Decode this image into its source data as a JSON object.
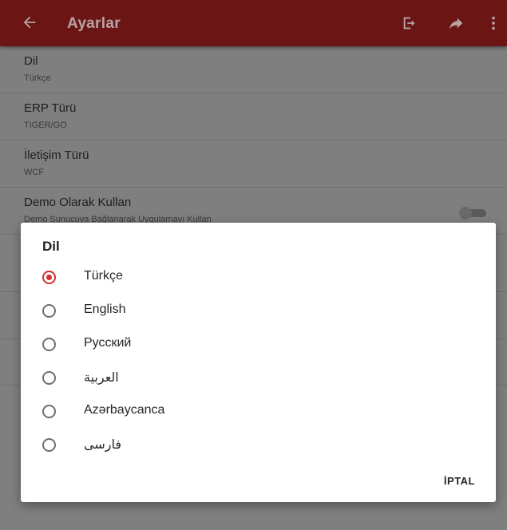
{
  "appbar": {
    "title": "Ayarlar",
    "icons": [
      "back-arrow-icon",
      "logout-icon",
      "share-forward-icon",
      "more-vertical-icon"
    ]
  },
  "settings": [
    {
      "title": "Dil",
      "subtitle": "Türkçe"
    },
    {
      "title": "ERP Türü",
      "subtitle": "TIGER/GO"
    },
    {
      "title": "İletişim Türü",
      "subtitle": "WCF"
    },
    {
      "title": "Demo Olarak Kullan",
      "subtitle": "Demo Sunucuya Bağlanarak Uygulamayı Kullan",
      "toggle": false
    }
  ],
  "dialog": {
    "title": "Dil",
    "options": [
      "Türkçe",
      "English",
      "Русский",
      "العربية",
      "Azərbaycanca",
      "فارسی"
    ],
    "selected": "Türkçe",
    "cancel_label": "İPTAL"
  },
  "colors": {
    "appbar": "#6b1515",
    "accent": "#d32f2f",
    "scrim_background": "#7f7f7f"
  }
}
